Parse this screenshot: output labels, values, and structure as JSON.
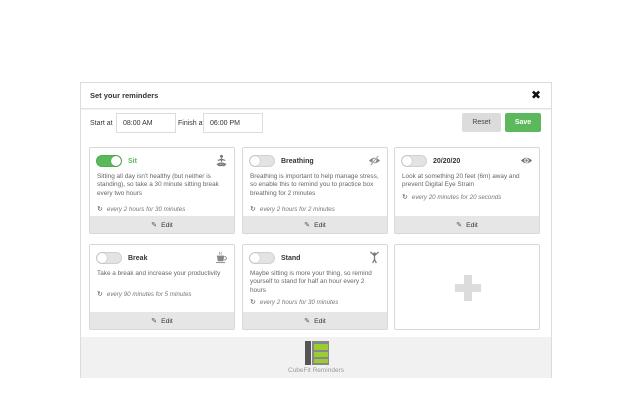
{
  "dialog": {
    "title": "Set your reminders",
    "close_icon": "close-icon"
  },
  "controls": {
    "start_label": "Start at",
    "start_value": "08:00 AM",
    "finish_label": "Finish at",
    "finish_value": "06:00 PM",
    "reset_label": "Reset",
    "save_label": "Save"
  },
  "cards": [
    {
      "name": "Sit",
      "enabled": true,
      "icon": "meditation-icon",
      "description": "Sitting all day isn't healthy (but neither is standing), so take a 30 minute sitting break every two hours",
      "frequency": "every 2 hours for 30 minutes",
      "edit_label": "Edit"
    },
    {
      "name": "Breathing",
      "enabled": false,
      "icon": "eye-slash-icon",
      "description": "Breathing is important to help manage stress, so enable this to remind you to practice box breathing for 2 minutes",
      "frequency": "every 2 hours for 2 minutes",
      "edit_label": "Edit"
    },
    {
      "name": "20/20/20",
      "enabled": false,
      "icon": "eye-icon",
      "description": "Look at something 20 feet (6m) away and prevent Digital Eye Strain",
      "frequency": "every 20 minutes for 20 seconds",
      "edit_label": "Edit"
    },
    {
      "name": "Break",
      "enabled": false,
      "icon": "coffee-cup-icon",
      "description": "Take a break and increase your productivity",
      "frequency": "every 90 minutes for 5 minutes",
      "edit_label": "Edit"
    },
    {
      "name": "Stand",
      "enabled": false,
      "icon": "standing-person-icon",
      "description": "Maybe sitting is more your thing, so remind yourself to stand for half an hour every 2 hours",
      "frequency": "every 2 hours for 30 minutes",
      "edit_label": "Edit"
    }
  ],
  "add_card": {
    "icon": "plus-icon"
  },
  "footer": {
    "brand": "CubeFit Reminders"
  },
  "colors": {
    "accent": "#5cb85c",
    "logo_green": "#9acd32",
    "logo_grey": "#555555"
  }
}
